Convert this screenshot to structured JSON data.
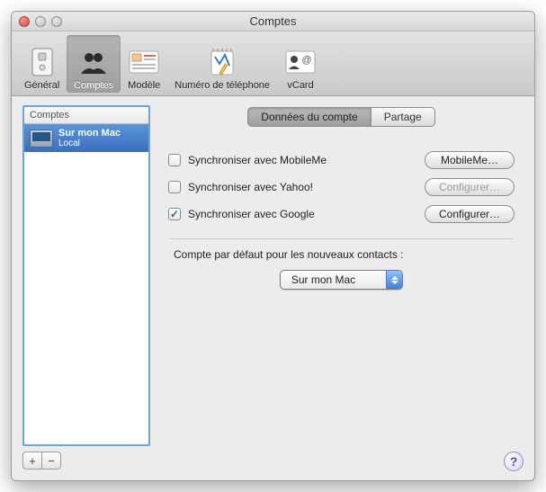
{
  "window": {
    "title": "Comptes"
  },
  "toolbar": {
    "items": [
      {
        "label": "Général"
      },
      {
        "label": "Comptes"
      },
      {
        "label": "Modèle"
      },
      {
        "label": "Numéro de téléphone"
      },
      {
        "label": "vCard"
      }
    ]
  },
  "sidebar": {
    "header": "Comptes",
    "rows": [
      {
        "line1": "Sur mon Mac",
        "line2": "Local"
      }
    ],
    "add_glyph": "+",
    "remove_glyph": "−"
  },
  "tabs": {
    "items": [
      {
        "label": "Données du compte"
      },
      {
        "label": "Partage"
      }
    ]
  },
  "sync": {
    "rows": [
      {
        "label": "Synchroniser avec MobileMe",
        "button": "MobileMe…",
        "checked": false,
        "enabled": true
      },
      {
        "label": "Synchroniser avec Yahoo!",
        "button": "Configurer…",
        "checked": false,
        "enabled": false
      },
      {
        "label": "Synchroniser avec Google",
        "button": "Configurer…",
        "checked": true,
        "enabled": true
      }
    ]
  },
  "default_account": {
    "label": "Compte par défaut pour les nouveaux contacts :",
    "value": "Sur mon Mac"
  },
  "help_glyph": "?"
}
